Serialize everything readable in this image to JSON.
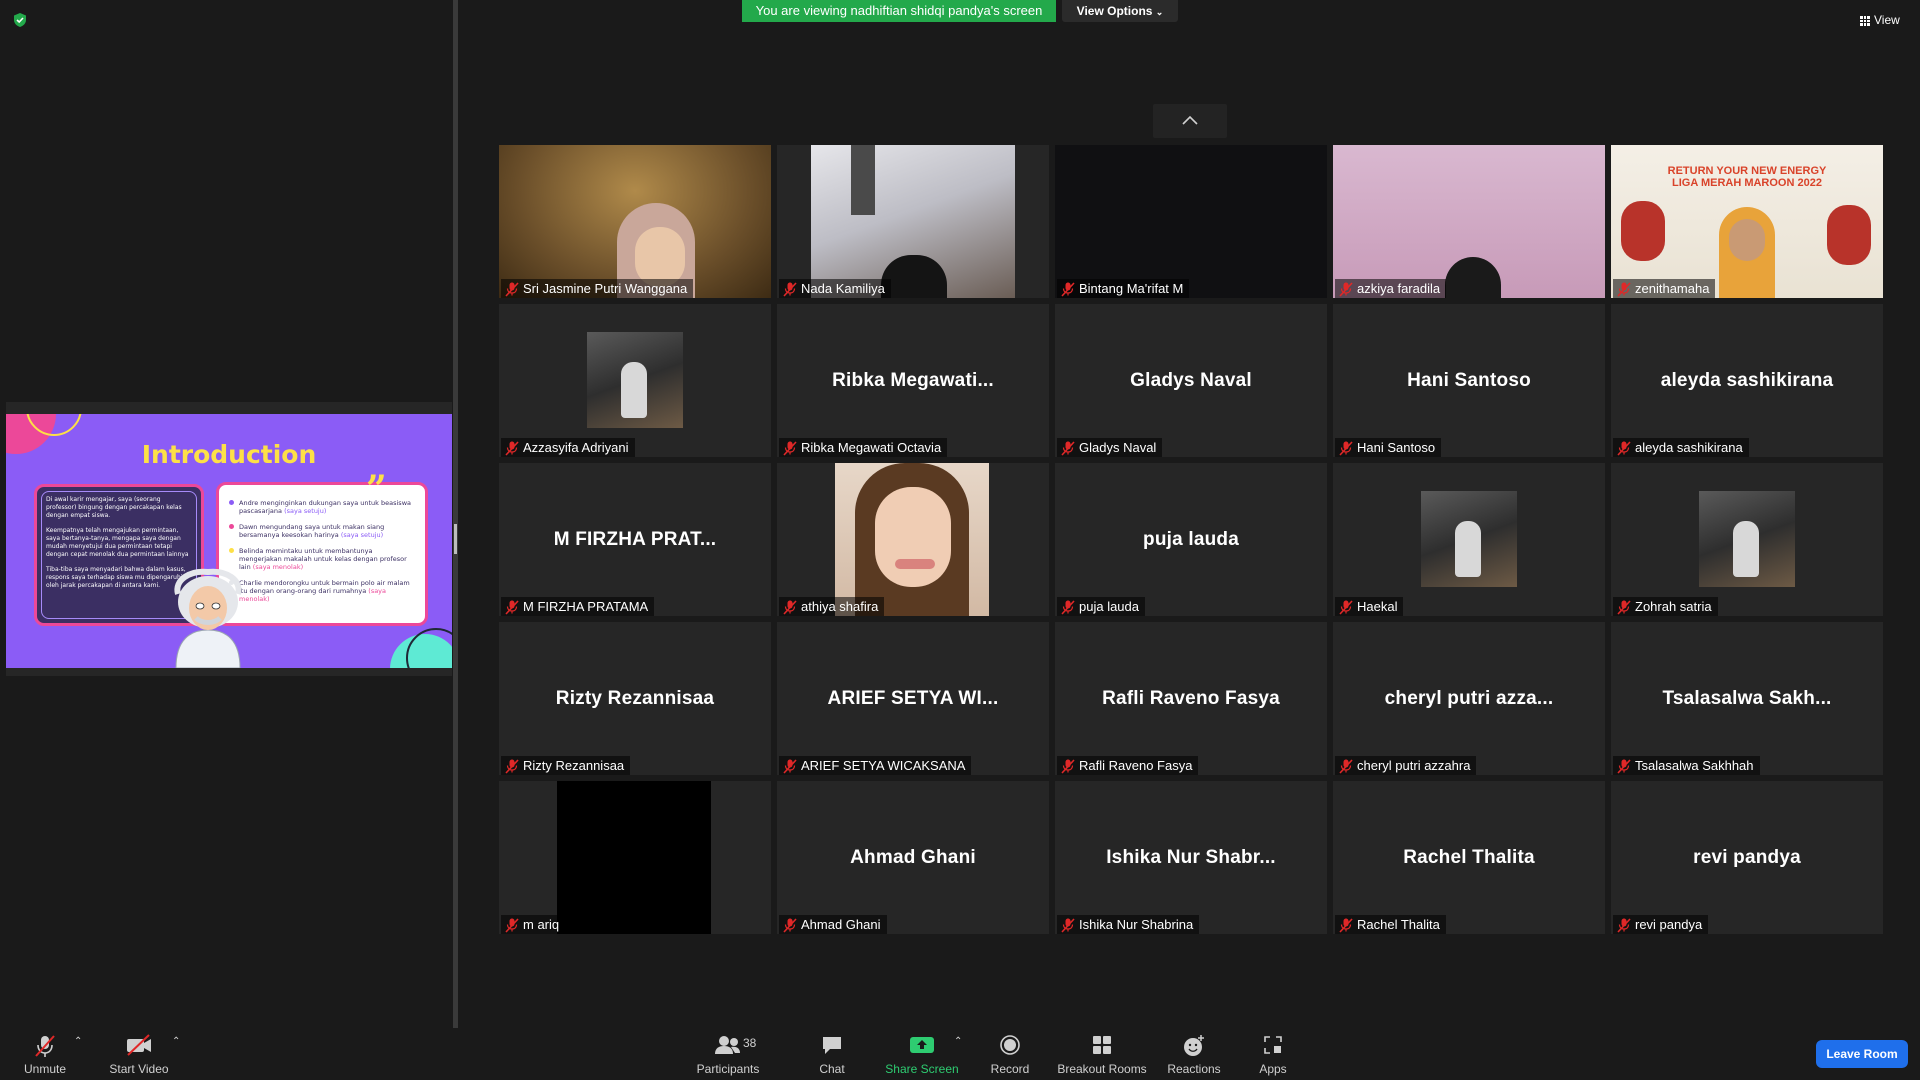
{
  "banner": {
    "sharing_text": "You are viewing nadhiftian shidqi pandya's screen",
    "view_options_label": "View Options"
  },
  "view_button_label": "View",
  "slide": {
    "title": "Introduction",
    "left_paragraphs": [
      "Di awal karir mengajar, saya (seorang professor) bingung dengan percakapan kelas dengan empat siswa.",
      "Keempatnya telah mengajukan permintaan, saya bertanya-tanya, mengapa saya dengan mudah menyetujui dua permintaan tetapi dengan cepat menolak dua permintaan lainnya",
      "Tiba-tiba saya menyadari bahwa dalam kasus, respons saya terhadap siswa mu dipengaruhi oleh jarak percakapan di antara kami."
    ],
    "bullets": [
      {
        "text": "Andre menginginkan dukungan saya untuk beasiswa pascasarjana",
        "note": "(saya setuju)",
        "color": "#8b5cf6"
      },
      {
        "text": "Dawn mengundang saya untuk makan siang bersamanya keesokan harinya",
        "note": "(saya setuju)",
        "color": "#ec4899"
      },
      {
        "text": "Belinda memintaku untuk membantunya mengerjakan makalah untuk kelas dengan profesor lain",
        "note": "(saya menolak)",
        "color": "#fde047"
      },
      {
        "text": "Charlie mendorongku untuk bermain polo air malam itu dengan orang-orang dari rumahnya",
        "note": "(saya menolak)",
        "color": "#ffffff"
      }
    ]
  },
  "participants": [
    {
      "name": "Sri Jasmine Putri Wanggana",
      "display": "",
      "video": "face-hijab",
      "muted": true
    },
    {
      "name": "Nada Kamiliya",
      "display": "",
      "video": "ceiling-hair",
      "muted": true
    },
    {
      "name": "Bintang Ma'rifat M",
      "display": "",
      "video": "dark",
      "muted": true
    },
    {
      "name": "azkiya faradila",
      "display": "",
      "video": "pink-wall",
      "muted": true
    },
    {
      "name": "zenithamaha",
      "display": "",
      "video": "poster-bg",
      "muted": true
    },
    {
      "name": "Azzasyifa Adriyani",
      "display": "",
      "video": "photo-small",
      "muted": true
    },
    {
      "name": "Ribka Megawati Octavia",
      "display": "Ribka Megawati...",
      "video": "",
      "muted": true
    },
    {
      "name": "Gladys Naval",
      "display": "Gladys Naval",
      "video": "",
      "muted": true
    },
    {
      "name": "Hani Santoso",
      "display": "Hani Santoso",
      "video": "",
      "muted": true
    },
    {
      "name": "aleyda sashikirana",
      "display": "aleyda sashikirana",
      "video": "",
      "muted": true
    },
    {
      "name": "M FIRZHA PRATAMA",
      "display": "M FIRZHA PRAT...",
      "video": "",
      "muted": true
    },
    {
      "name": "athiya shafira",
      "display": "",
      "video": "portrait",
      "muted": true
    },
    {
      "name": "puja lauda",
      "display": "puja lauda",
      "video": "",
      "muted": true
    },
    {
      "name": "Haekal",
      "display": "",
      "video": "photo-small",
      "muted": true
    },
    {
      "name": "Zohrah satria",
      "display": "",
      "video": "photo-small",
      "muted": true
    },
    {
      "name": "Rizty Rezannisaa",
      "display": "Rizty Rezannisaa",
      "video": "",
      "muted": true
    },
    {
      "name": "ARIEF SETYA WICAKSANA",
      "display": "ARIEF SETYA WI...",
      "video": "",
      "muted": true
    },
    {
      "name": "Rafli Raveno Fasya",
      "display": "Rafli Raveno Fasya",
      "video": "",
      "muted": true
    },
    {
      "name": "cheryl putri azzahra",
      "display": "cheryl putri azza...",
      "video": "",
      "muted": true
    },
    {
      "name": "Tsalasalwa Sakhhah",
      "display": "Tsalasalwa Sakh...",
      "video": "",
      "muted": true
    },
    {
      "name": "m ariq",
      "display": "",
      "video": "black",
      "muted": true
    },
    {
      "name": "Ahmad Ghani",
      "display": "Ahmad Ghani",
      "video": "",
      "muted": true
    },
    {
      "name": "Ishika Nur Shabrina",
      "display": "Ishika Nur Shabr...",
      "video": "",
      "muted": true
    },
    {
      "name": "Rachel Thalita",
      "display": "Rachel Thalita",
      "video": "",
      "muted": true
    },
    {
      "name": "revi pandya",
      "display": "revi pandya",
      "video": "",
      "muted": true
    }
  ],
  "toolbar": {
    "unmute": "Unmute",
    "start_video": "Start Video",
    "participants": "Participants",
    "participants_count": "38",
    "chat": "Chat",
    "share_screen": "Share Screen",
    "record": "Record",
    "breakout_rooms": "Breakout Rooms",
    "reactions": "Reactions",
    "apps": "Apps",
    "leave_room": "Leave Room"
  },
  "colors": {
    "banner_green": "#23a94b",
    "share_green": "#2ecc71",
    "leave_blue": "#1f6feb",
    "muted_red": "#e02828",
    "slide_purple": "#8b5cf6"
  }
}
